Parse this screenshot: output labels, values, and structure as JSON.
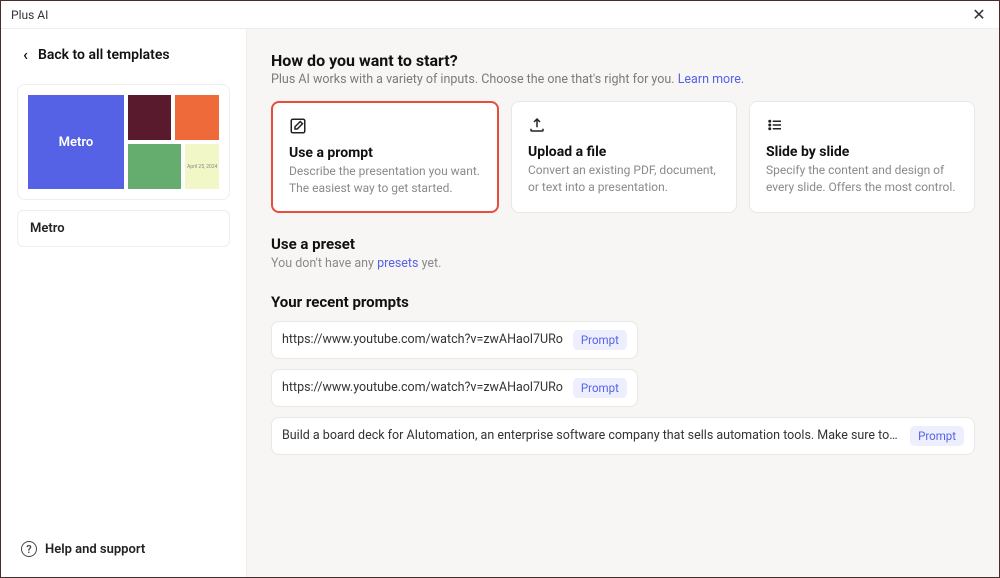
{
  "window": {
    "title": "Plus AI"
  },
  "sidebar": {
    "back_label": "Back to all templates",
    "template_preview_label": "Metro",
    "template_preview_date": "April 25, 2024",
    "template_name": "Metro",
    "help_label": "Help and support"
  },
  "main": {
    "heading": "How do you want to start?",
    "subheading_text": "Plus AI works with a variety of inputs. Choose the one that's right for you.",
    "subheading_link": "Learn more.",
    "cards": [
      {
        "title": "Use a prompt",
        "desc": "Describe the presentation you want. The easiest way to get started."
      },
      {
        "title": "Upload a file",
        "desc": "Convert an existing PDF, document, or text into a presentation."
      },
      {
        "title": "Slide by slide",
        "desc": "Specify the content and design of every slide. Offers the most control."
      }
    ],
    "preset": {
      "heading": "Use a preset",
      "sub_prefix": "You don't have any ",
      "sub_link": "presets",
      "sub_suffix": " yet."
    },
    "recent": {
      "heading": "Your recent prompts",
      "badge_label": "Prompt",
      "items": [
        "https://www.youtube.com/watch?v=zwAHaol7URo",
        "https://www.youtube.com/watch?v=zwAHaol7URo",
        "Build a board deck for AIutomation, an enterprise software company that sells automation tools. Make sure to start with a C…"
      ]
    }
  }
}
